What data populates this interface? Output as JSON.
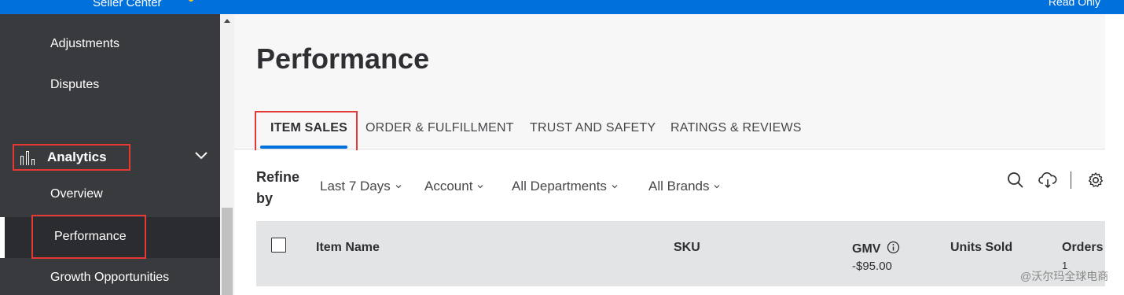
{
  "topbar": {
    "brand": "Seller Center",
    "role": "Read Only"
  },
  "sidebar": {
    "items": [
      {
        "label": "Adjustments"
      },
      {
        "label": "Disputes"
      },
      {
        "label": "Analytics"
      },
      {
        "label": "Overview"
      },
      {
        "label": "Performance"
      },
      {
        "label": "Growth Opportunities"
      }
    ]
  },
  "page": {
    "title": "Performance"
  },
  "tabs": [
    {
      "label": "ITEM SALES"
    },
    {
      "label": "ORDER & FULFILLMENT"
    },
    {
      "label": "TRUST AND SAFETY"
    },
    {
      "label": "RATINGS & REVIEWS"
    }
  ],
  "filters": {
    "refine_label": "Refine by",
    "items": [
      {
        "label": "Last 7 Days"
      },
      {
        "label": "Account"
      },
      {
        "label": "All Departments"
      },
      {
        "label": "All Brands"
      }
    ]
  },
  "table": {
    "headers": {
      "item_name": "Item Name",
      "sku": "SKU",
      "gmv": "GMV",
      "units_sold": "Units Sold",
      "orders": "Orders"
    },
    "totals": {
      "gmv": "-$95.00",
      "orders": "1"
    }
  },
  "watermark": "@沃尔玛全球电商",
  "colors": {
    "brand_blue": "#0071dc",
    "highlight_red": "#e53935",
    "sidebar_bg": "#393a3d"
  }
}
